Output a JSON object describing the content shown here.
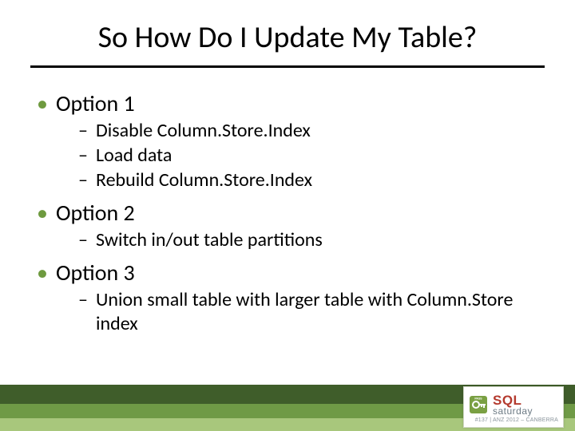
{
  "title": "So How Do I Update My Table?",
  "bullets": {
    "opt1": {
      "label": "Option 1",
      "items": [
        "Disable Column.Store.Index",
        "Load data",
        "Rebuild Column.Store.Index"
      ]
    },
    "opt2": {
      "label": "Option 2",
      "items": [
        "Switch in/out table partitions"
      ]
    },
    "opt3": {
      "label": "Option 3",
      "items": [
        "Union small table with larger table with Column.Store index"
      ]
    }
  },
  "footer": {
    "logo_brand_1": "SQL",
    "logo_brand_2": "saturday",
    "logo_sub": "#137 | ANZ 2012 – CANBERRA"
  }
}
